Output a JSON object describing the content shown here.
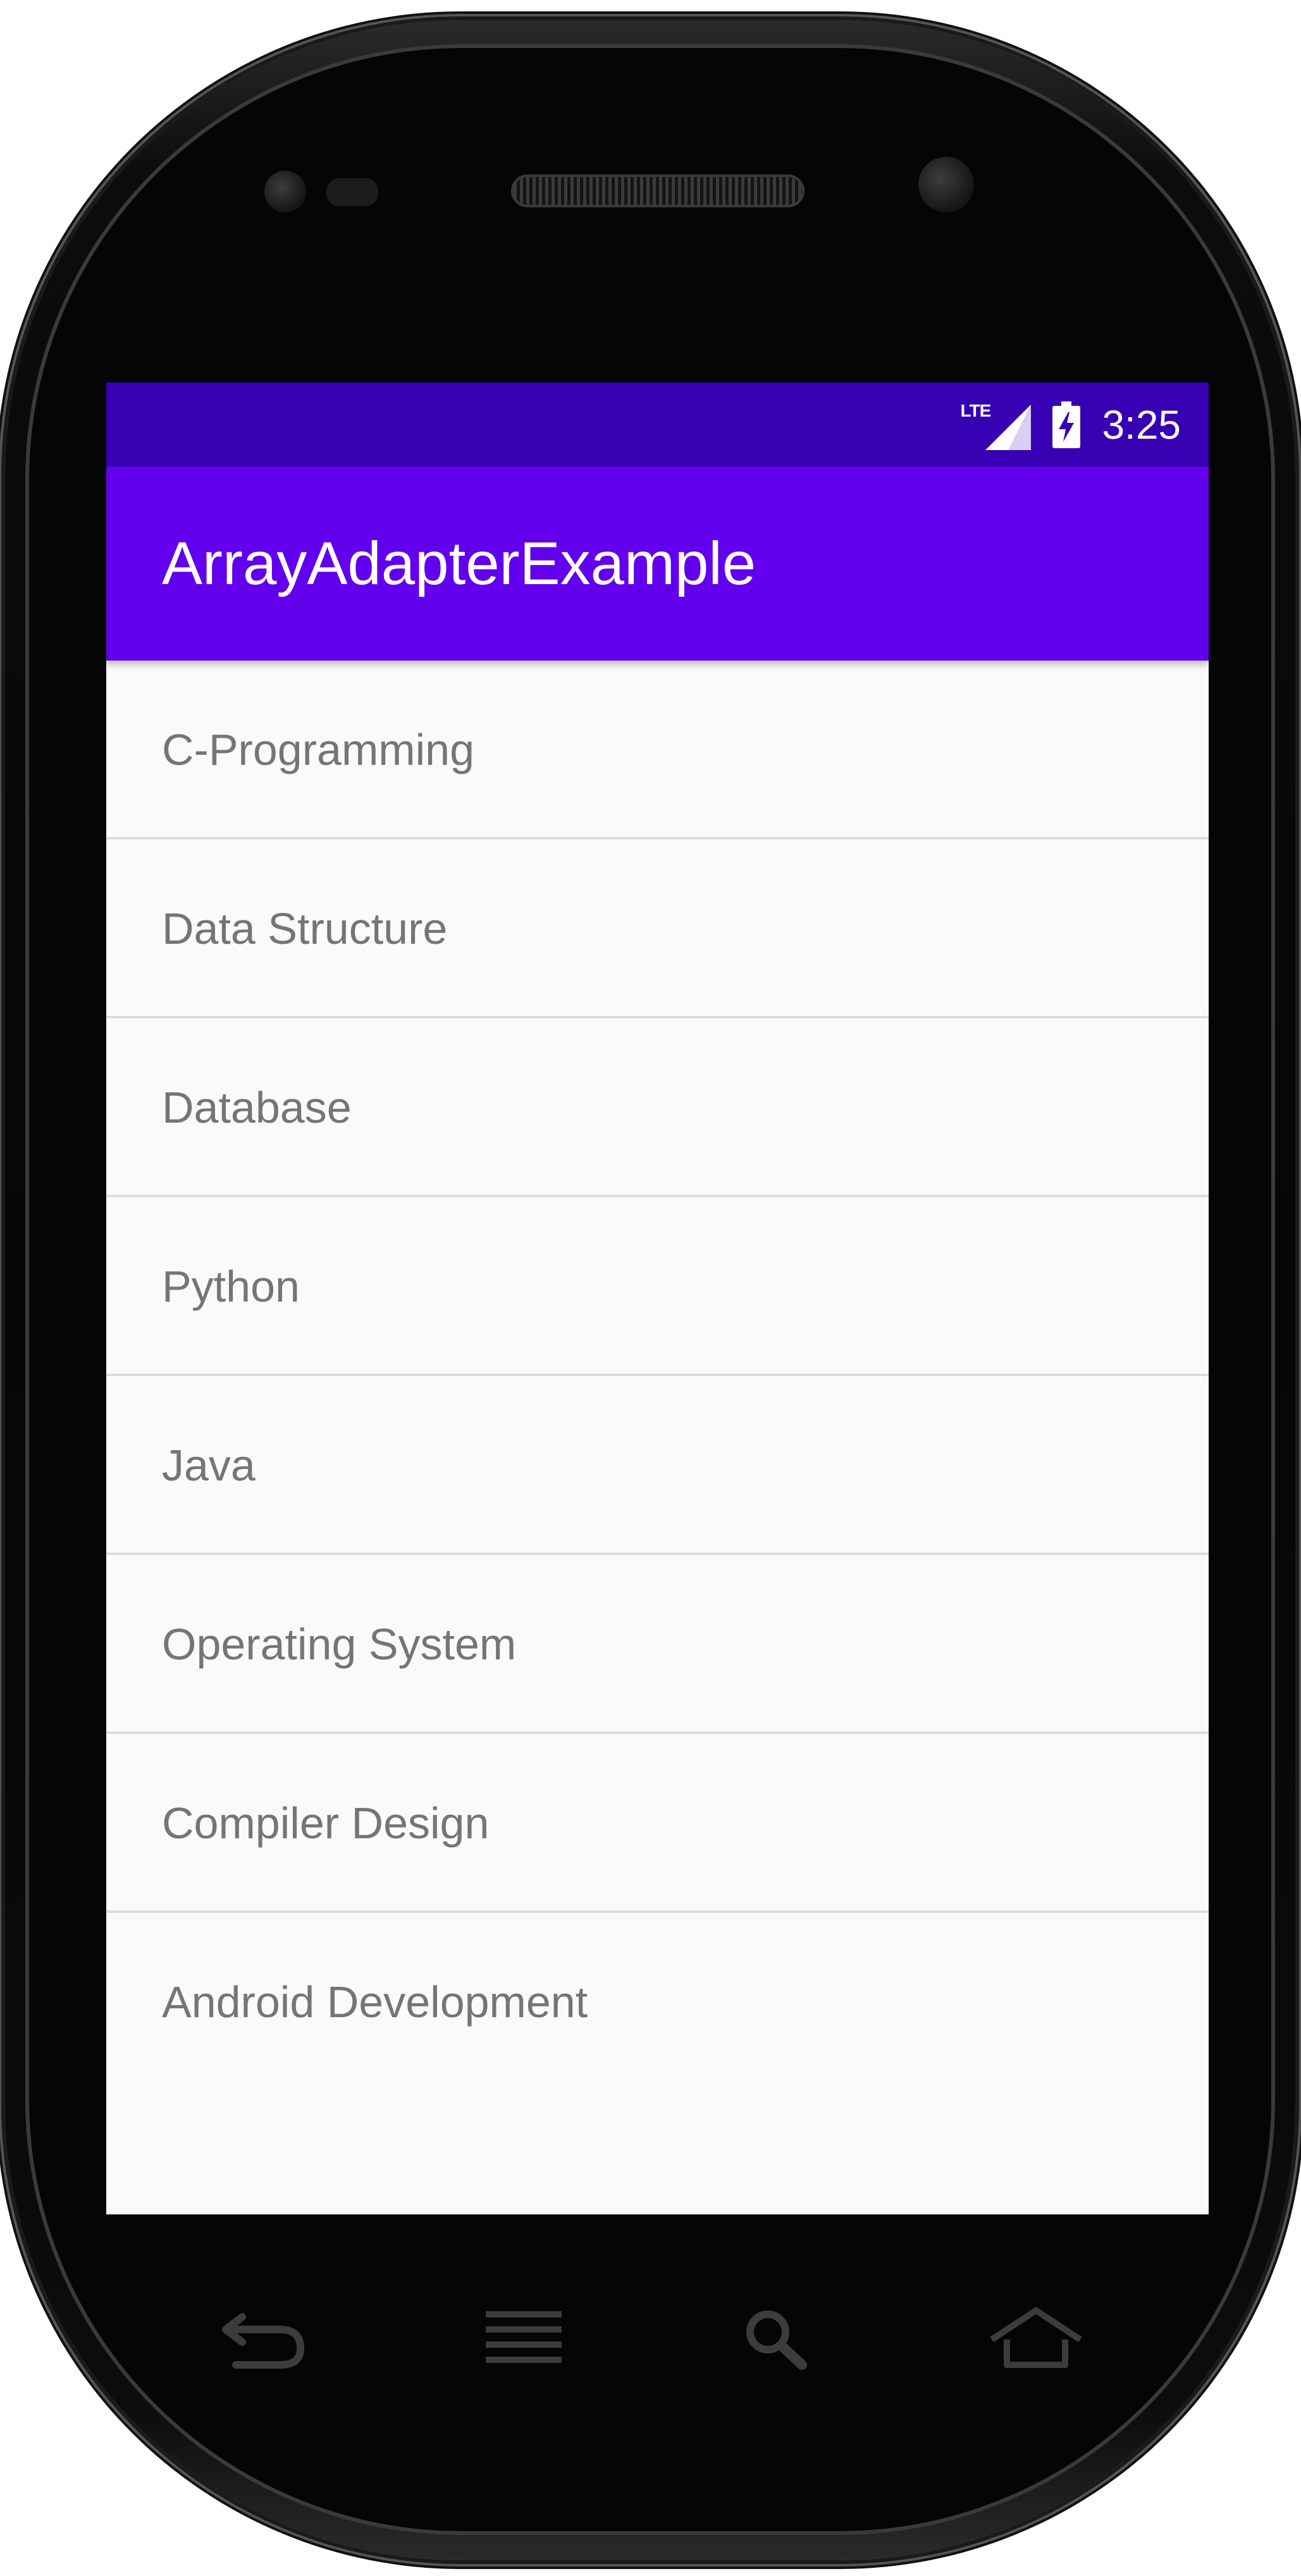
{
  "status_bar": {
    "network_label": "LTE",
    "time": "3:25",
    "icons": [
      "lte-signal-icon",
      "battery-charging-icon"
    ]
  },
  "app_bar": {
    "title": "ArrayAdapterExample",
    "color": "#6200ee",
    "status_color": "#3700b3"
  },
  "list": {
    "items": [
      {
        "label": "C-Programming"
      },
      {
        "label": "Data Structure"
      },
      {
        "label": "Database"
      },
      {
        "label": "Python"
      },
      {
        "label": "Java"
      },
      {
        "label": "Operating System"
      },
      {
        "label": "Compiler Design"
      },
      {
        "label": "Android Development"
      }
    ]
  },
  "hardware_nav": {
    "buttons": [
      "back-icon",
      "menu-icon",
      "search-icon",
      "home-icon"
    ]
  }
}
